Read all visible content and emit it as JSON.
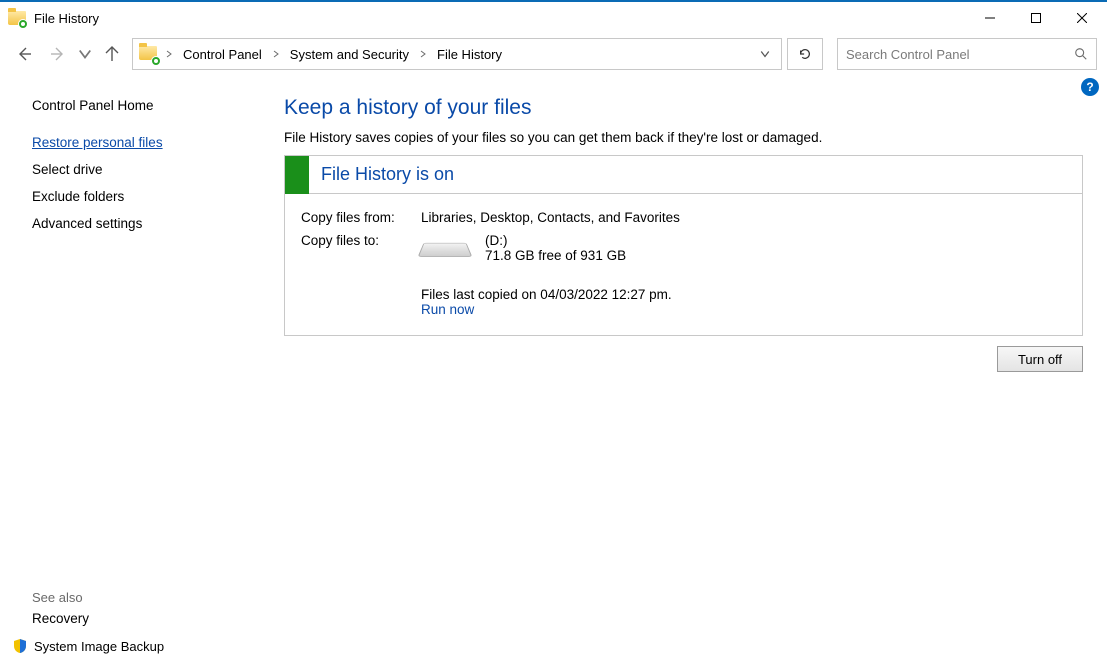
{
  "window": {
    "title": "File History"
  },
  "breadcrumbs": {
    "items": [
      "Control Panel",
      "System and Security",
      "File History"
    ]
  },
  "search": {
    "placeholder": "Search Control Panel"
  },
  "sidebar": {
    "home": "Control Panel Home",
    "links": [
      {
        "label": "Restore personal files",
        "active": true
      },
      {
        "label": "Select drive",
        "active": false
      },
      {
        "label": "Exclude folders",
        "active": false
      },
      {
        "label": "Advanced settings",
        "active": false
      }
    ],
    "see_also_label": "See also",
    "see_also": [
      {
        "label": "Recovery",
        "shield": false
      },
      {
        "label": "System Image Backup",
        "shield": true
      }
    ]
  },
  "main": {
    "heading": "Keep a history of your files",
    "subtitle": "File History saves copies of your files so you can get them back if they're lost or damaged.",
    "status_title": "File History is on",
    "copy_from_label": "Copy files from:",
    "copy_from_value": "Libraries, Desktop, Contacts, and Favorites",
    "copy_to_label": "Copy files to:",
    "drive_name": "(D:)",
    "drive_space": "71.8 GB free of 931 GB",
    "last_copied": "Files last copied on 04/03/2022 12:27 pm.",
    "run_now": "Run now",
    "turn_off": "Turn off"
  }
}
